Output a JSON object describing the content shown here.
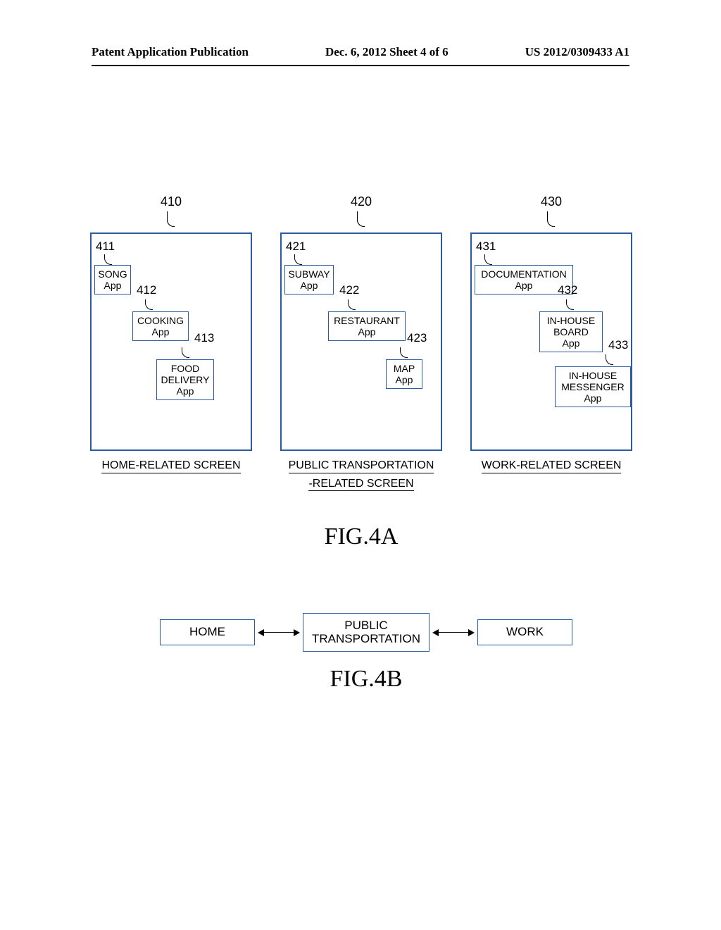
{
  "header": {
    "left": "Patent Application Publication",
    "mid": "Dec. 6, 2012  Sheet 4 of 6",
    "right": "US 2012/0309433 A1"
  },
  "fig4a": {
    "label": "FIG.4A",
    "screens": [
      {
        "ref": "410",
        "caption": "HOME-RELATED SCREEN",
        "apps": [
          {
            "ref": "411",
            "line1": "SONG",
            "line2": "App"
          },
          {
            "ref": "412",
            "line1": "COOKING",
            "line2": "App"
          },
          {
            "ref": "413",
            "line1": "FOOD",
            "line2": "DELIVERY",
            "line3": "App"
          }
        ]
      },
      {
        "ref": "420",
        "caption": "PUBLIC TRANSPORTATION -RELATED SCREEN",
        "caption_l1": "PUBLIC TRANSPORTATION",
        "caption_l2": "-RELATED SCREEN",
        "apps": [
          {
            "ref": "421",
            "line1": "SUBWAY",
            "line2": "App"
          },
          {
            "ref": "422",
            "line1": "RESTAURANT",
            "line2": "App"
          },
          {
            "ref": "423",
            "line1": "MAP",
            "line2": "App"
          }
        ]
      },
      {
        "ref": "430",
        "caption": "WORK-RELATED SCREEN",
        "apps": [
          {
            "ref": "431",
            "line1": "DOCUMENTATION",
            "line2": "App"
          },
          {
            "ref": "432",
            "line1": "IN-HOUSE",
            "line2": "BOARD",
            "line3": "App"
          },
          {
            "ref": "433",
            "line1": "IN-HOUSE",
            "line2": "MESSENGER",
            "line3": "App"
          }
        ]
      }
    ]
  },
  "fig4b": {
    "label": "FIG.4B",
    "boxes": [
      {
        "line1": "HOME"
      },
      {
        "line1": "PUBLIC",
        "line2": "TRANSPORTATION"
      },
      {
        "line1": "WORK"
      }
    ]
  }
}
